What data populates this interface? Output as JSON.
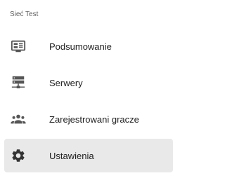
{
  "sidebar": {
    "section_title": "Sieć Test",
    "items": [
      {
        "label": "Podsumowanie",
        "icon": "dashboard-monitor-icon",
        "active": false
      },
      {
        "label": "Serwery",
        "icon": "servers-icon",
        "active": false
      },
      {
        "label": "Zarejestrowani gracze",
        "icon": "people-group-icon",
        "active": false
      },
      {
        "label": "Ustawienia",
        "icon": "gear-icon",
        "active": true
      }
    ]
  },
  "colors": {
    "icon": "#555555",
    "active_background": "#e9e9e9",
    "text": "#212121",
    "section_title": "#616161"
  }
}
